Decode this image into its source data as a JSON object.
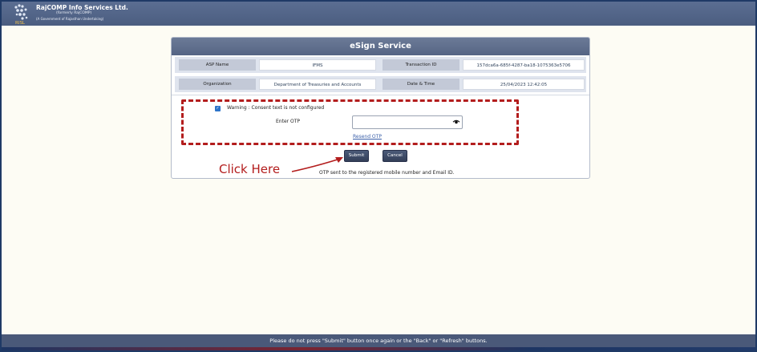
{
  "header": {
    "brand_name": "RajCOMP Info Services Ltd.",
    "brand_formerly": "(formerly RajCOMP)",
    "brand_tagline": "(A Government of Rajasthan Undertaking)"
  },
  "panel": {
    "title": "eSign Service",
    "rows": [
      {
        "label1": "ASP Name",
        "value1": "IFMS",
        "label2": "Transaction ID",
        "value2": "157dca6a-685f-4287-ba18-1075363e5706"
      },
      {
        "label1": "Organization",
        "value1": "Department of Treasuries and Accounts",
        "label2": "Date & Time",
        "value2": "25/04/2023 12:42:05"
      }
    ],
    "consent_warning": "Warning : Consent text is not configured",
    "otp_label": "Enter OTP",
    "otp_value": "",
    "resend_label": "Resend OTP",
    "submit_label": "Submit",
    "cancel_label": "Cancel",
    "otp_note": "OTP sent to the registered mobile number and Email ID."
  },
  "annotation": {
    "click_here": "Click Here",
    "color": "#b31d1d"
  },
  "footer": {
    "text": "Please do not press \"Submit\" button once again or the \"Back\" or \"Refresh\" buttons."
  }
}
